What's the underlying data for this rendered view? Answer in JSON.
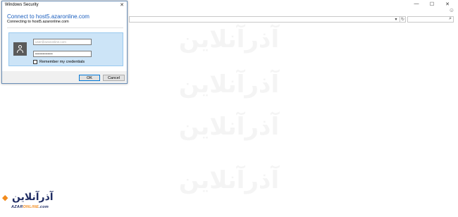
{
  "background": {
    "window_controls": {
      "minimize": "—",
      "maximize": "☐",
      "close": "✕"
    },
    "address_bar": {
      "value": "",
      "dropdown": "▾",
      "refresh": "↻"
    },
    "search": {
      "value": "",
      "icon": "search-icon"
    },
    "feedback_icon": "☺",
    "watermark_text": "آذرآنلاین"
  },
  "dialog": {
    "title": "Windows Security",
    "close": "✕",
    "heading": "Connect to host5.azaronline.com",
    "subtitle": "Connecting to host5.azaronline.com",
    "username_value": "user@azaronline.com",
    "password_value": "••••••••••••••",
    "remember_label": "Remember my credentials",
    "remember_checked": false,
    "ok_label": "OK",
    "cancel_label": "Cancel",
    "user_icon": "user-icon"
  },
  "logo": {
    "persian": "آذرآنلاین",
    "latin_part1": "AZAR",
    "latin_part2": "ONLINE",
    "latin_suffix": ".com",
    "colors": {
      "primary": "#1f2c63",
      "accent": "#f28b1c"
    }
  },
  "colors": {
    "heading": "#1b5ebe",
    "panel": "#cce4f7",
    "panel_border": "#99c9ef"
  }
}
